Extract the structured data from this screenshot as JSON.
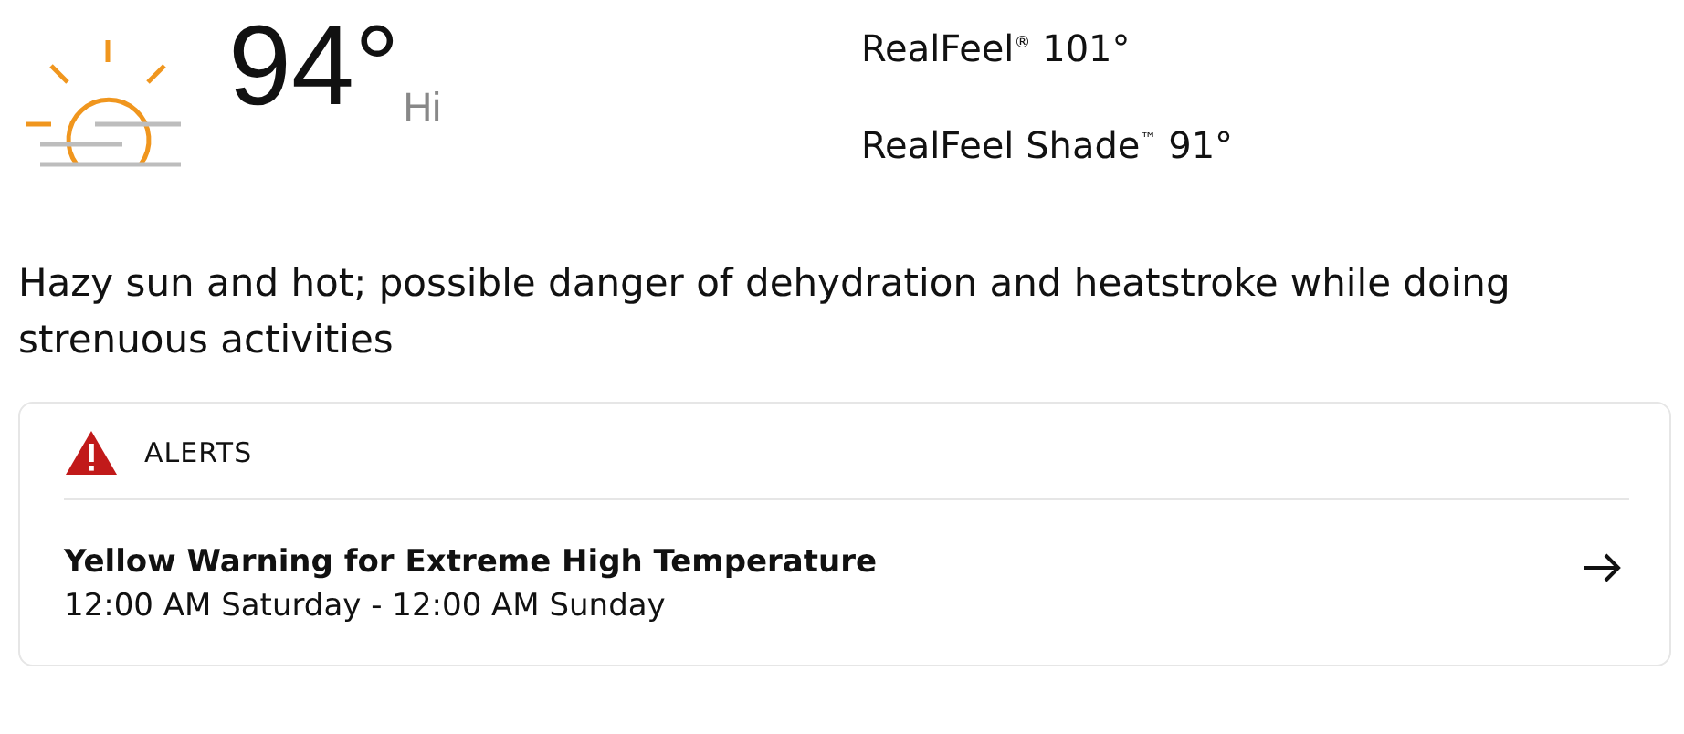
{
  "current": {
    "temperature": "94°",
    "label": "Hi"
  },
  "realfeel": [
    {
      "text": "RealFeel$^{®}$ 101°"
    },
    {
      "text": "RealFeel Shade$^{™}$ 91°"
    }
  ],
  "description": "Hazy sun and hot; possible danger of dehydration and heatstroke while doing strenuous activities",
  "alerts": {
    "heading": "ALERTS",
    "items": [
      {
        "title": "Yellow Warning for Extreme High Temperature",
        "time": "12:00 AM Saturday - 12:00 AM Sunday"
      }
    ]
  }
}
